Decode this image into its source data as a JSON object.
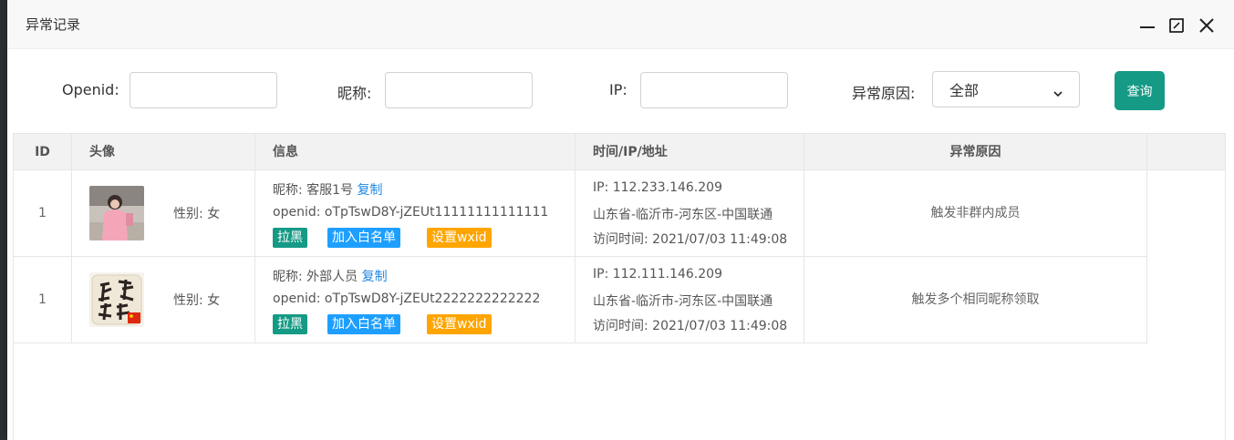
{
  "dialog": {
    "title": "异常记录"
  },
  "search": {
    "openid_label": "Openid:",
    "openid_value": "",
    "nickname_label": "昵称:",
    "nickname_value": "",
    "ip_label": "IP:",
    "ip_value": "",
    "reason_label": "异常原因:",
    "reason_selected": "全部",
    "query_button": "查询"
  },
  "table": {
    "headers": [
      "ID",
      "头像",
      "信息",
      "时间/IP/地址",
      "异常原因"
    ],
    "rows": [
      {
        "id": "1",
        "gender": "性别: 女",
        "nickname_line": "昵称: 客服1号",
        "copy": "复制",
        "openid_line": "openid: oTpTswD8Y-jZEUt11111111111111",
        "tag_black": "拉黑",
        "tag_white": "加入白名单",
        "tag_wxid": "设置wxid",
        "ip_line": "IP: 112.233.146.209",
        "location_line": "山东省-临沂市-河东区-中国联通",
        "visit_line": "访问时间: 2021/07/03 11:49:08",
        "reason": "触发非群内成员"
      },
      {
        "id": "1",
        "gender": "性别: 女",
        "nickname_line": "昵称: 外部人员",
        "copy": "复制",
        "openid_line": "openid: oTpTswD8Y-jZEUt2222222222222",
        "tag_black": "拉黑",
        "tag_white": "加入白名单",
        "tag_wxid": "设置wxid",
        "ip_line": "IP: 112.111.146.209",
        "location_line": "山东省-临沂市-河东区-中国联通",
        "visit_line": "访问时间: 2021/07/03 11:49:08",
        "reason": "触发多个相同昵称领取"
      }
    ]
  },
  "colors": {
    "primary": "#159a86",
    "blue_tag": "#1e9fff",
    "orange_tag": "#ffa500",
    "link": "#1e88e5"
  }
}
